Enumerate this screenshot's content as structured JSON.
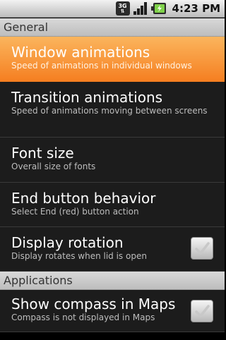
{
  "status_bar": {
    "network_badge": "3G",
    "time": "4:23 PM",
    "icons": [
      "network-3g-icon",
      "signal-strength-icon",
      "battery-charging-icon"
    ]
  },
  "sections": [
    {
      "header": "General",
      "items": [
        {
          "title": "Window animations",
          "summary": "Speed of animations in individual windows",
          "selected": true
        },
        {
          "title": "Transition animations",
          "summary": "Speed of animations moving between screens"
        },
        {
          "title": "Font size",
          "summary": "Overall size of fonts"
        },
        {
          "title": "End button behavior",
          "summary": "Select End (red) button action"
        },
        {
          "title": "Display rotation",
          "summary": "Display rotates when lid is open",
          "checked": true
        }
      ]
    },
    {
      "header": "Applications",
      "items": [
        {
          "title": "Show compass in Maps",
          "summary": "Compass is not displayed in Maps",
          "checked": false
        }
      ]
    }
  ],
  "colors": {
    "selection_top": "#fbb55d",
    "selection_bottom": "#f57e20",
    "list_background": "#1c1c1c",
    "header_background": "#cfcfcf"
  }
}
